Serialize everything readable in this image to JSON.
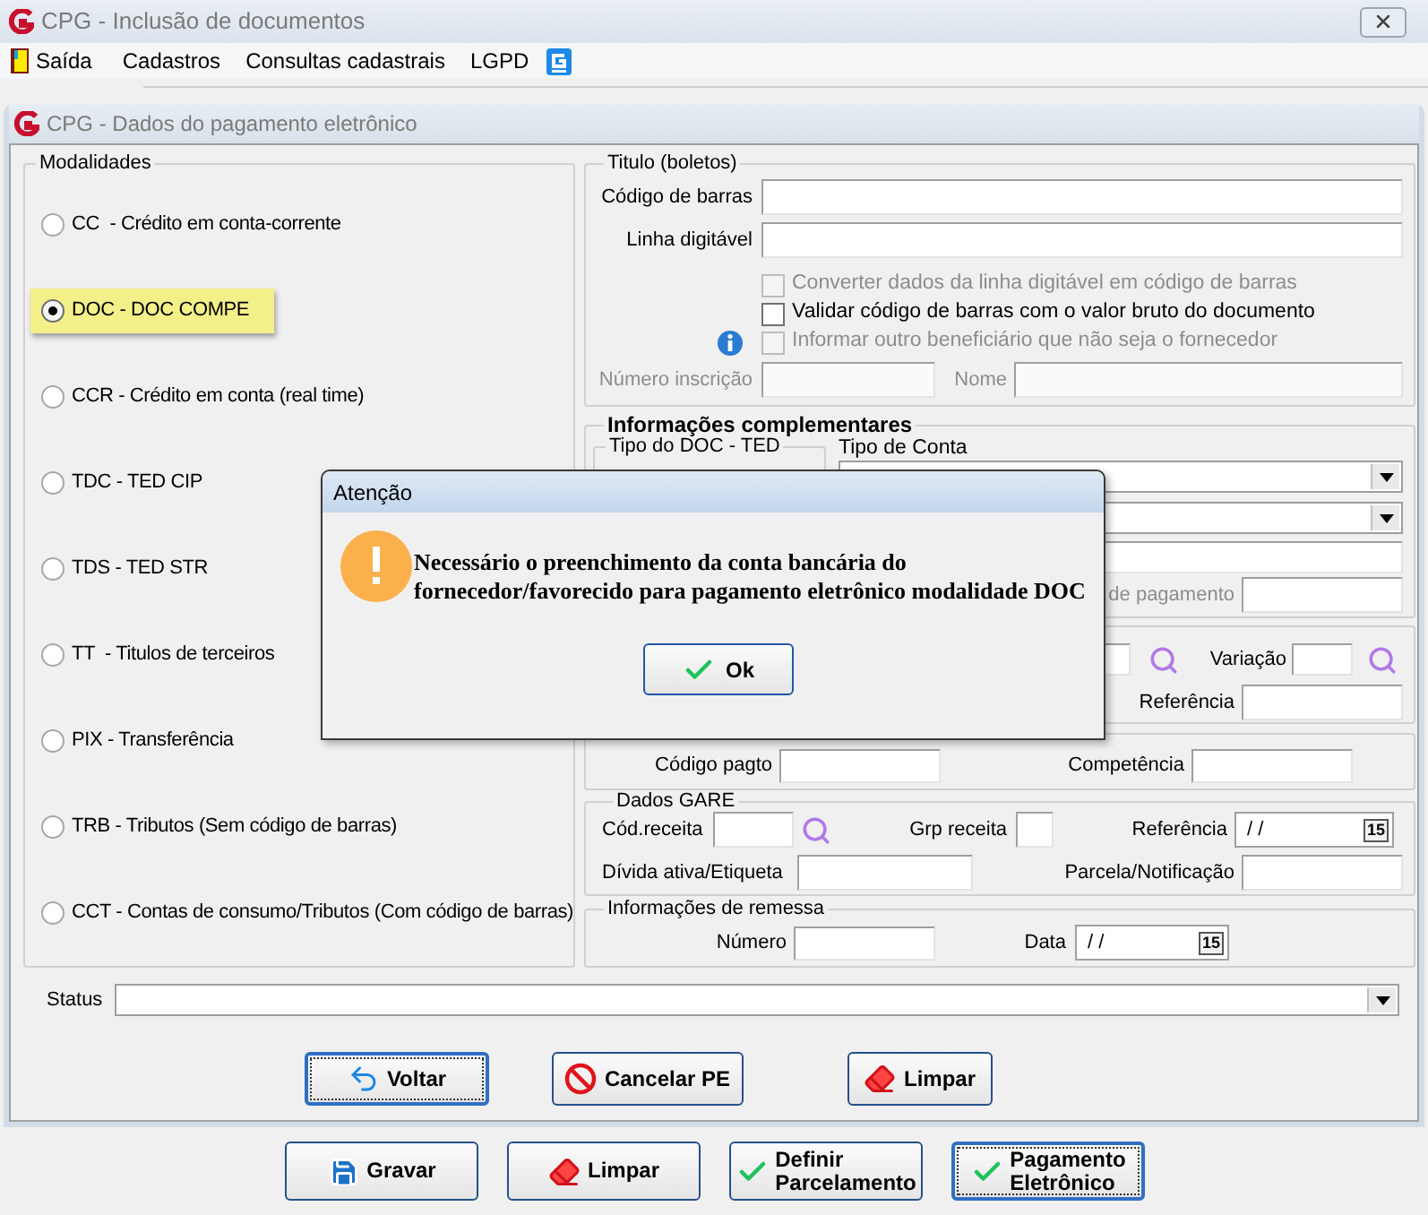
{
  "window": {
    "title": "CPG - Inclusão de documentos"
  },
  "menu": [
    {
      "label": "Saída",
      "kind": "exit"
    },
    {
      "label": "Cadastros",
      "kind": "plain"
    },
    {
      "label": "Consultas cadastrais",
      "kind": "plain"
    },
    {
      "label": "LGPD",
      "kind": "plain"
    },
    {
      "kind": "logo"
    }
  ],
  "inner_window": {
    "title": "CPG - Dados do pagamento eletrônico"
  },
  "modalidades": {
    "title": "Modalidades",
    "options": [
      {
        "label": "CC  - Crédito em conta-corrente",
        "selected": false
      },
      {
        "label": "DOC - DOC COMPE",
        "selected": true
      },
      {
        "label": "CCR - Crédito em conta (real time)",
        "selected": false
      },
      {
        "label": "TDC - TED CIP",
        "selected": false
      },
      {
        "label": "TDS - TED STR",
        "selected": false
      },
      {
        "label": "TT  - Titulos de terceiros",
        "selected": false
      },
      {
        "label": "PIX - Transferência",
        "selected": false
      },
      {
        "label": "TRB - Tributos (Sem código de barras)",
        "selected": false
      },
      {
        "label": "CCT - Contas de consumo/Tributos (Com código de barras)",
        "selected": false
      }
    ]
  },
  "titulo": {
    "title": "Titulo (boletos)",
    "fields": [
      {
        "label": "Código de barras"
      },
      {
        "label": "Linha digitável"
      }
    ],
    "checkboxes": [
      {
        "label": "Converter dados da linha digitável em código de barras",
        "checked": false,
        "disabled": true,
        "info": false
      },
      {
        "label": "Validar código de barras com o valor bruto do documento",
        "checked": false,
        "disabled": false,
        "info": false
      },
      {
        "label": "Informar outro beneficiário que não seja o fornecedor",
        "checked": false,
        "disabled": true,
        "info": true
      }
    ],
    "inscricao": {
      "label": "Número inscrição",
      "disabled": true
    },
    "nome": {
      "label": "Nome",
      "disabled": true
    }
  },
  "complementares": {
    "title": "Informações complementares",
    "tipo_doc_ted": {
      "title": "Tipo do DOC - TED"
    },
    "tipo_conta": {
      "label": "Tipo de Conta"
    },
    "pagamento": {
      "label": "de pagamento"
    }
  },
  "identificacao": {
    "variacao": {
      "label": "Variação"
    },
    "referencia": {
      "label": "Referência"
    }
  },
  "pagto": {
    "codigo": {
      "label": "Código pagto"
    },
    "competencia": {
      "label": "Competência"
    }
  },
  "gare": {
    "title": "Dados GARE",
    "cod_receita": {
      "label": "Cód.receita"
    },
    "grp_receita": {
      "label": "Grp receita"
    },
    "referencia": {
      "label": "Referência",
      "value": "/ /",
      "calendar_day": "15"
    },
    "divida": {
      "label": "Dívida ativa/Etiqueta"
    },
    "parcela": {
      "label": "Parcela/Notificação"
    }
  },
  "remessa": {
    "title": "Informações de remessa",
    "numero": {
      "label": "Número"
    },
    "data": {
      "label": "Data",
      "value": "/ /",
      "calendar_day": "15"
    }
  },
  "status": {
    "label": "Status"
  },
  "panel_buttons": [
    {
      "lines": [
        "Voltar"
      ],
      "kind": "back",
      "focused": true
    },
    {
      "lines": [
        "Cancelar PE"
      ],
      "kind": "cancel",
      "focused": false
    },
    {
      "lines": [
        "Limpar"
      ],
      "kind": "clear",
      "focused": false
    }
  ],
  "footer_buttons": [
    {
      "lines": [
        "Gravar"
      ],
      "kind": "save",
      "focused": false
    },
    {
      "lines": [
        "Limpar"
      ],
      "kind": "clear",
      "focused": false
    },
    {
      "lines": [
        "Definir",
        "Parcelamento"
      ],
      "kind": "confirm",
      "focused": false
    },
    {
      "lines": [
        "Pagamento",
        "Eletrônico"
      ],
      "kind": "confirm",
      "focused": true
    }
  ],
  "dialog": {
    "title": "Atenção",
    "lines": [
      "Necessário o preenchimento da conta bancária do",
      "fornecedor/favorecido para pagamento eletrônico modalidade DOC"
    ],
    "button": "Ok"
  }
}
